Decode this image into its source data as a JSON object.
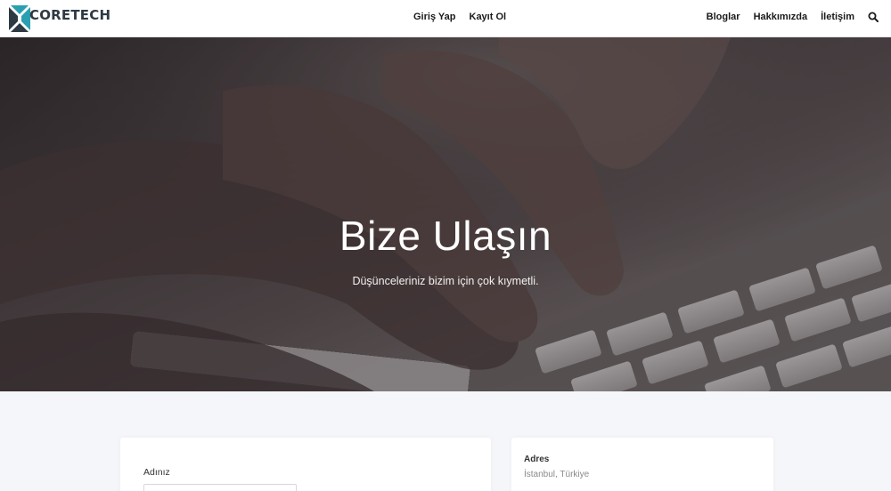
{
  "brand": {
    "name": "CORETECH",
    "colors": {
      "accent": "#2a9fb0",
      "dark": "#2d3a44"
    }
  },
  "nav": {
    "login": "Giriş Yap",
    "register": "Kayıt Ol",
    "blogs": "Bloglar",
    "about": "Hakkımızda",
    "contact": "İletişim",
    "search_icon": "search-icon"
  },
  "hero": {
    "title": "Bize Ulaşın",
    "subtitle": "Düşünceleriniz bizim için çok kıymetli."
  },
  "form": {
    "name_label": "Adınız",
    "name_value": ""
  },
  "info": {
    "address_title": "Adres",
    "address_value": "İstanbul, Türkiye"
  }
}
